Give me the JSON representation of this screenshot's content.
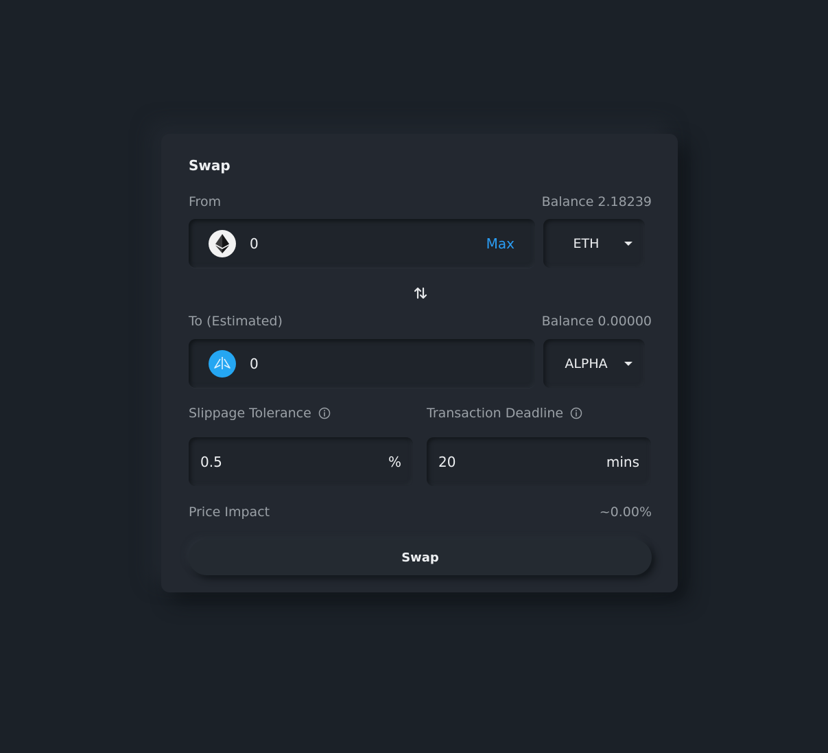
{
  "swap": {
    "title": "Swap",
    "from": {
      "label": "From",
      "balance": "Balance 2.18239",
      "amount": "0",
      "max_label": "Max",
      "token": "ETH"
    },
    "to": {
      "label": "To (Estimated)",
      "balance": "Balance 0.00000",
      "amount": "0",
      "token": "ALPHA"
    },
    "slippage": {
      "label": "Slippage Tolerance",
      "value": "0.5",
      "unit": "%"
    },
    "deadline": {
      "label": "Transaction Deadline",
      "value": "20",
      "unit": "mins"
    },
    "price_impact": {
      "label": "Price Impact",
      "value": "~0.00%"
    },
    "button_label": "Swap"
  },
  "colors": {
    "background": "#1b2128",
    "card": "#232830",
    "accent": "#2a9df4",
    "alpha_logo": "#25a6f2"
  },
  "icons": {
    "from_token": "ethereum-icon",
    "to_token": "alpha-icon",
    "switch": "swap-arrows-icon",
    "info": "info-icon",
    "dropdown": "chevron-down-icon"
  }
}
